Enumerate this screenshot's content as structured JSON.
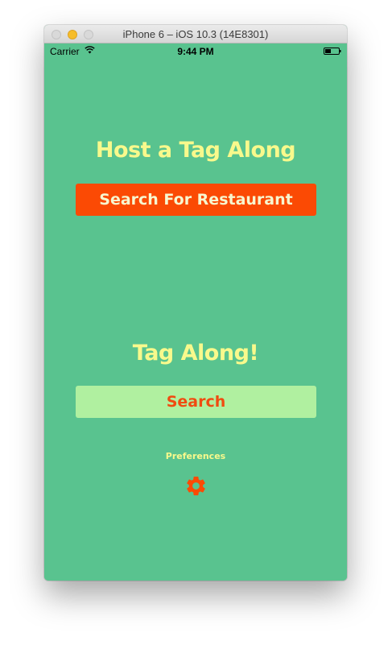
{
  "window": {
    "title": "iPhone 6 – iOS 10.3 (14E8301)"
  },
  "status_bar": {
    "carrier": "Carrier",
    "time": "9:44 PM"
  },
  "host": {
    "title": "Host a Tag Along",
    "button_label": "Search For Restaurant"
  },
  "tag_along": {
    "title": "Tag Along!",
    "button_label": "Search"
  },
  "preferences": {
    "label": "Preferences",
    "icon": "gear-icon"
  },
  "colors": {
    "background": "#59c38f",
    "title_text": "#f8f98c",
    "primary_button": "#fb4a04",
    "secondary_button": "#b0f0a0",
    "accent_orange": "#f04b10"
  }
}
